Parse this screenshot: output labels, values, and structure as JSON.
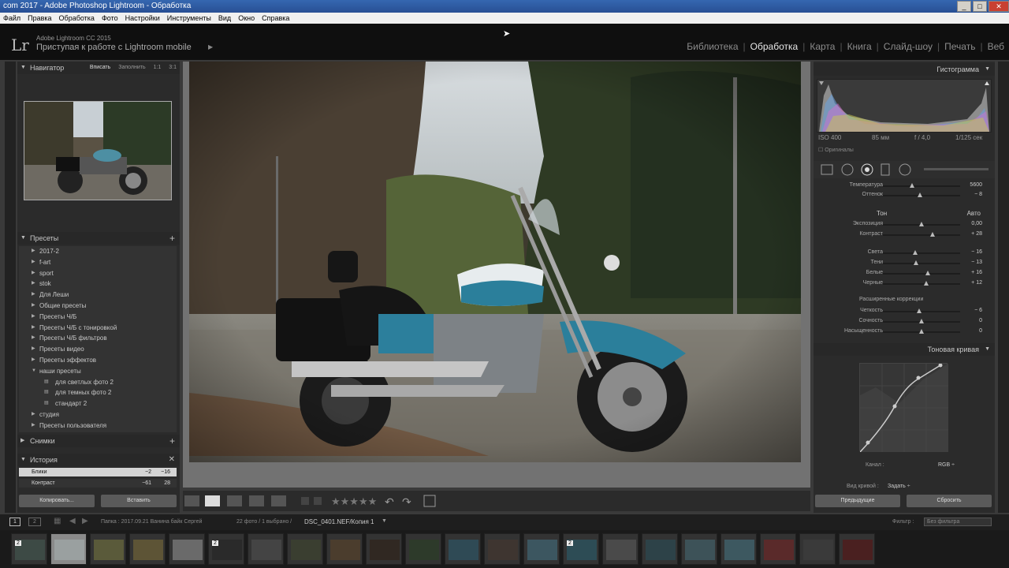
{
  "window": {
    "title": "com 2017 - Adobe Photoshop Lightroom - Обработка",
    "min": "_",
    "max": "□",
    "close": "✕"
  },
  "menu": [
    "Файл",
    "Правка",
    "Обработка",
    "Фото",
    "Настройки",
    "Инструменты",
    "Вид",
    "Окно",
    "Справка"
  ],
  "identity": {
    "logo": "Lr",
    "app_name": "Adobe Lightroom CC 2015",
    "mobile_text": "Приступая к работе с Lightroom mobile"
  },
  "modules": [
    "Библиотека",
    "Обработка",
    "Карта",
    "Книга",
    "Слайд-шоу",
    "Печать",
    "Веб"
  ],
  "navigator": {
    "title": "Навигатор",
    "options": [
      "Вписать",
      "Заполнить",
      "1:1",
      "3:1"
    ]
  },
  "presets": {
    "title": "Пресеты",
    "items": [
      {
        "label": "2017-2",
        "sub": false,
        "ar": "▶"
      },
      {
        "label": "f-art",
        "sub": false,
        "ar": "▶"
      },
      {
        "label": "sport",
        "sub": false,
        "ar": "▶"
      },
      {
        "label": "stok",
        "sub": false,
        "ar": "▶"
      },
      {
        "label": "Для Леши",
        "sub": false,
        "ar": "▶"
      },
      {
        "label": "Общие пресеты",
        "sub": false,
        "ar": "▶"
      },
      {
        "label": "Пресеты Ч/Б",
        "sub": false,
        "ar": "▶"
      },
      {
        "label": "Пресеты Ч/Б с тонировкой",
        "sub": false,
        "ar": "▶"
      },
      {
        "label": "Пресеты Ч/Б фильтров",
        "sub": false,
        "ar": "▶"
      },
      {
        "label": "Пресеты видео",
        "sub": false,
        "ar": "▶"
      },
      {
        "label": "Пресеты эффектов",
        "sub": false,
        "ar": "▶"
      },
      {
        "label": "наши пресеты",
        "sub": false,
        "ar": "▼"
      },
      {
        "label": "для светлых фото 2",
        "sub": true,
        "ar": "▤"
      },
      {
        "label": "для темных фото 2",
        "sub": true,
        "ar": "▤"
      },
      {
        "label": "стандарт 2",
        "sub": true,
        "ar": "▤"
      },
      {
        "label": "студия",
        "sub": false,
        "ar": "▶"
      },
      {
        "label": "Пресеты пользователя",
        "sub": false,
        "ar": "▶"
      }
    ]
  },
  "snapshots": {
    "title": "Снимки"
  },
  "history": {
    "title": "История",
    "items": [
      {
        "label": "Блики",
        "v1": "−2",
        "v2": "−16"
      },
      {
        "label": "Контраст",
        "v1": "−61",
        "v2": "28"
      }
    ]
  },
  "left_buttons": {
    "copy": "Копировать...",
    "paste": "Вставить"
  },
  "histogram": {
    "title": "Гистограмма",
    "iso": "ISO 400",
    "focal": "85 мм",
    "aperture": "f / 4,0",
    "shutter": "1/125 сек",
    "originals": "Оригиналы"
  },
  "basic": {
    "rows": [
      {
        "label": "Температура",
        "value": "5600",
        "pos": 0.38
      },
      {
        "label": "Оттенок",
        "value": "− 8",
        "pos": 0.48
      },
      {
        "label": "Экспозиция",
        "value": "0,00",
        "pos": 0.5
      },
      {
        "label": "Контраст",
        "value": "+ 28",
        "pos": 0.64
      },
      {
        "label": "Света",
        "value": "− 16",
        "pos": 0.42
      },
      {
        "label": "Тени",
        "value": "− 13",
        "pos": 0.43
      },
      {
        "label": "Белые",
        "value": "+ 16",
        "pos": 0.58
      },
      {
        "label": "Черные",
        "value": "+ 12",
        "pos": 0.56
      },
      {
        "label": "Четкость",
        "value": "− 6",
        "pos": 0.47
      },
      {
        "label": "Сочность",
        "value": "0",
        "pos": 0.5
      },
      {
        "label": "Насыщенность",
        "value": "0",
        "pos": 0.5
      }
    ],
    "tone_label": "Тон",
    "auto": "Авто",
    "presence": "Расширенные коррекции"
  },
  "tonecurve": {
    "title": "Тоновая кривая",
    "channel_label": "Канал :",
    "channel": "RGB ÷",
    "curve_label": "Вид кривой :",
    "curve_value": "Задать ÷"
  },
  "right_buttons": {
    "previous": "Предыдущие",
    "reset": "Сбросить"
  },
  "filmstrip": {
    "page1": "1",
    "page2": "2",
    "path": "Папка : 2017.09.21 Ванина байк Сергей",
    "count": "22 фото / 1 выбрано /",
    "file": "DSC_0401.NEF/Копия 1",
    "filter_label": "Фильтр :",
    "filter_value": "Без фильтра"
  },
  "thumbs": [
    {
      "badge": "2",
      "c": "#3d4a45"
    },
    {
      "badge": "",
      "c": "#9aa0a0"
    },
    {
      "badge": "",
      "c": "#5a5a3a"
    },
    {
      "badge": "",
      "c": "#5d5436"
    },
    {
      "badge": "",
      "c": "#6a6a6a"
    },
    {
      "badge": "2",
      "c": "#2a2a2a"
    },
    {
      "badge": "",
      "c": "#444"
    },
    {
      "badge": "",
      "c": "#3a3e30"
    },
    {
      "badge": "",
      "c": "#4b3d2d"
    },
    {
      "badge": "",
      "c": "#302822"
    },
    {
      "badge": "",
      "c": "#2d3a2a"
    },
    {
      "badge": "",
      "c": "#2f4a55"
    },
    {
      "badge": "",
      "c": "#3e3530"
    },
    {
      "badge": "",
      "c": "#3c5660"
    },
    {
      "badge": "2",
      "c": "#2d4c55"
    },
    {
      "badge": "",
      "c": "#4a4a4a"
    },
    {
      "badge": "",
      "c": "#2d4248"
    },
    {
      "badge": "",
      "c": "#3d5258"
    },
    {
      "badge": "",
      "c": "#3d5860"
    },
    {
      "badge": "",
      "c": "#5a2a2a"
    },
    {
      "badge": "",
      "c": "#3a3a3a"
    },
    {
      "badge": "",
      "c": "#4a2020"
    }
  ]
}
